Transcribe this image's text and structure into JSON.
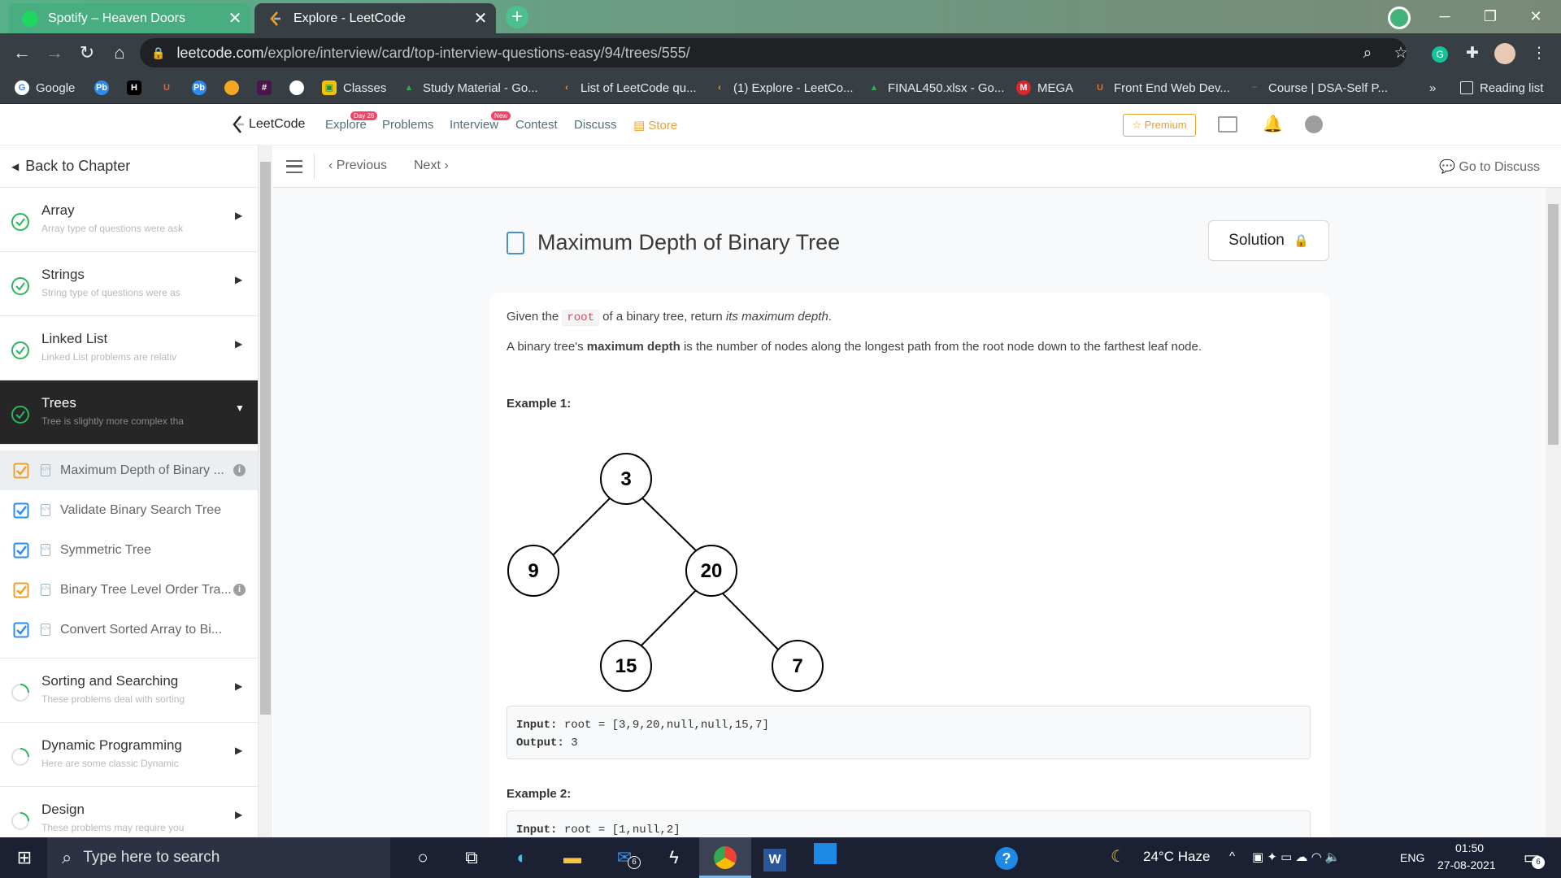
{
  "browser": {
    "tabs": [
      {
        "title": "Spotify – Heaven Doors",
        "active": false
      },
      {
        "title": "Explore - LeetCode",
        "active": true
      }
    ],
    "url_host": "leetcode.com",
    "url_path": "/explore/interview/card/top-interview-questions-easy/94/trees/555/",
    "bookmarks": [
      "Google",
      "Classes",
      "Study Material - Go...",
      "List of LeetCode qu...",
      "(1) Explore - LeetCo...",
      "FINAL450.xlsx - Go...",
      "MEGA",
      "Front End Web Dev...",
      "Course | DSA-Self P..."
    ],
    "bookmarks_more": "»",
    "reading_list": "Reading list"
  },
  "leetcode_nav": {
    "logo_text": "LeetCode",
    "links": {
      "explore": "Explore",
      "problems": "Problems",
      "interview": "Interview",
      "contest": "Contest",
      "discuss": "Discuss",
      "store": "Store"
    },
    "explore_badge": "Day 26",
    "interview_badge": "New",
    "premium": "☆ Premium"
  },
  "sidebar": {
    "back": "Back to Chapter",
    "chapters_top": [
      {
        "name": "Array",
        "desc": "Array type of questions were ask",
        "status": "done"
      },
      {
        "name": "Strings",
        "desc": "String type of questions were as",
        "status": "done"
      },
      {
        "name": "Linked List",
        "desc": "Linked List problems are relativ",
        "status": "done"
      },
      {
        "name": "Trees",
        "desc": "Tree is slightly more complex tha",
        "status": "done"
      }
    ],
    "items": [
      {
        "label": "Maximum Depth of Binary ...",
        "check": "orange",
        "info": true
      },
      {
        "label": "Validate Binary Search Tree",
        "check": "blue",
        "info": false
      },
      {
        "label": "Symmetric Tree",
        "check": "blue",
        "info": false
      },
      {
        "label": "Binary Tree Level Order Tra...",
        "check": "orange",
        "info": true
      },
      {
        "label": "Convert Sorted Array to Bi...",
        "check": "blue",
        "info": false
      }
    ],
    "chapters_bottom": [
      {
        "name": "Sorting and Searching",
        "desc": "These problems deal with sorting",
        "status": "partial"
      },
      {
        "name": "Dynamic Programming",
        "desc": "Here are some classic Dynamic",
        "status": "partial"
      },
      {
        "name": "Design",
        "desc": "These problems may require you",
        "status": "partial"
      }
    ]
  },
  "subbar": {
    "previous": "Previous",
    "next": "Next",
    "discuss": "Go to Discuss"
  },
  "problem": {
    "title": "Maximum Depth of Binary Tree",
    "solution": "Solution",
    "p1_pre": "Given the ",
    "p1_code": "root",
    "p1_mid": " of a binary tree, return ",
    "p1_em": "its maximum depth",
    "p1_end": ".",
    "p2_pre": "A binary tree's ",
    "p2_bold": "maximum depth",
    "p2_end": " is the number of nodes along the longest path from the root node down to the farthest leaf node.",
    "example1": "Example 1:",
    "tree_nodes": [
      "3",
      "9",
      "20",
      "15",
      "7"
    ],
    "ex1_input_label": "Input:",
    "ex1_input": " root = [3,9,20,null,null,15,7]",
    "ex1_output_label": "Output:",
    "ex1_output": " 3",
    "example2": "Example 2:",
    "ex2_input_label": "Input:",
    "ex2_input": " root = [1,null,2]"
  },
  "taskbar": {
    "search_placeholder": "Type here to search",
    "mail_count": "6",
    "weather": "24°C  Haze",
    "lang": "ENG",
    "time": "01:50",
    "date": "27-08-2021",
    "notif_count": "6"
  },
  "colors": {
    "check_orange": "#f0a02a",
    "check_blue": "#2d8cf0",
    "green_check": "#2db55d",
    "accent": "#4a90c2"
  }
}
